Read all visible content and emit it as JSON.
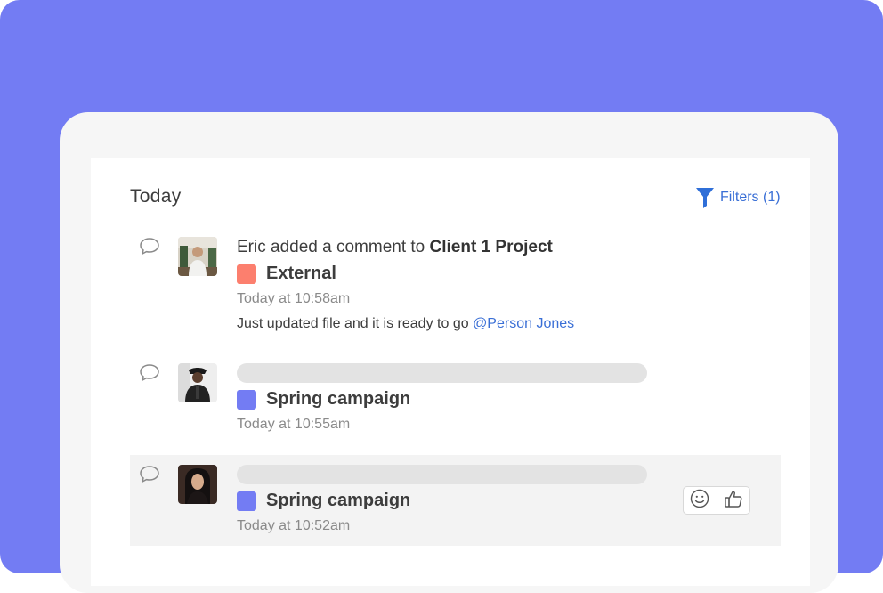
{
  "header": {
    "title": "Today",
    "filters_label": "Filters (1)"
  },
  "colors": {
    "background": "#737cf3",
    "accent_link": "#3a6fd6",
    "tag_external": "#fc7f6e",
    "tag_spring_campaign": "#737cf3"
  },
  "activities": [
    {
      "actor": "Eric",
      "action": " added a comment to ",
      "target": "Client 1 Project",
      "tag": {
        "label": "External",
        "color": "#fc7f6e"
      },
      "time": "Today at 10:58am",
      "comment": "Just updated file and it is ready to go ",
      "mention": "@Person Jones",
      "icon": "comment-icon"
    },
    {
      "tag": {
        "label": "Spring campaign",
        "color": "#737cf3"
      },
      "time": "Today at 10:55am",
      "icon": "comment-icon"
    },
    {
      "tag": {
        "label": "Spring campaign",
        "color": "#737cf3"
      },
      "time": "Today at 10:52am",
      "icon": "comment-icon",
      "reactions": [
        "smiley-icon",
        "thumbs-up-icon"
      ]
    }
  ]
}
